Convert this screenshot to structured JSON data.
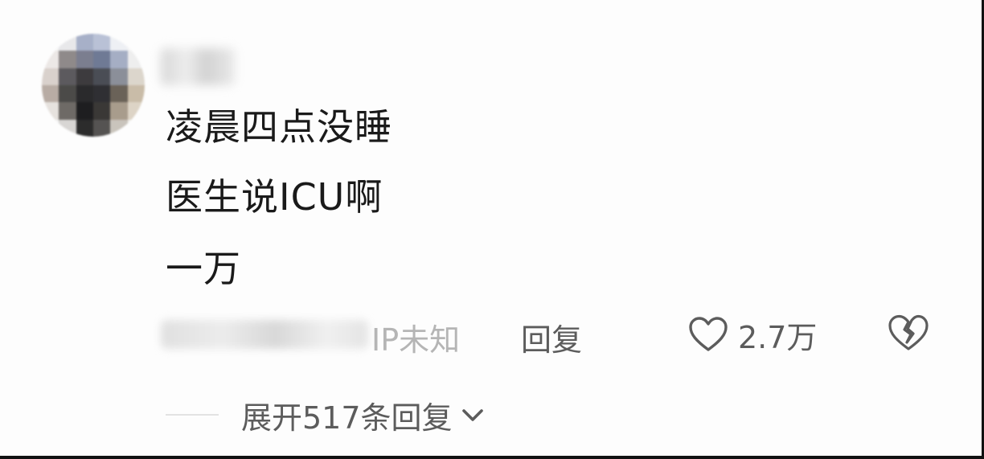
{
  "comment": {
    "lines": [
      "凌晨四点没睡",
      "医生说ICU啊",
      "一万"
    ],
    "ip_label": "IP未知",
    "reply_label": "回复",
    "like_count": "2.7万",
    "expand_label": "展开517条回复"
  },
  "icons": {
    "like": "heart-outline-icon",
    "dislike": "broken-heart-icon",
    "expand": "chevron-down-icon"
  },
  "colors": {
    "text_primary": "#1a1a1a",
    "text_secondary": "#5c5c5c",
    "text_muted": "#b5b5b5"
  }
}
